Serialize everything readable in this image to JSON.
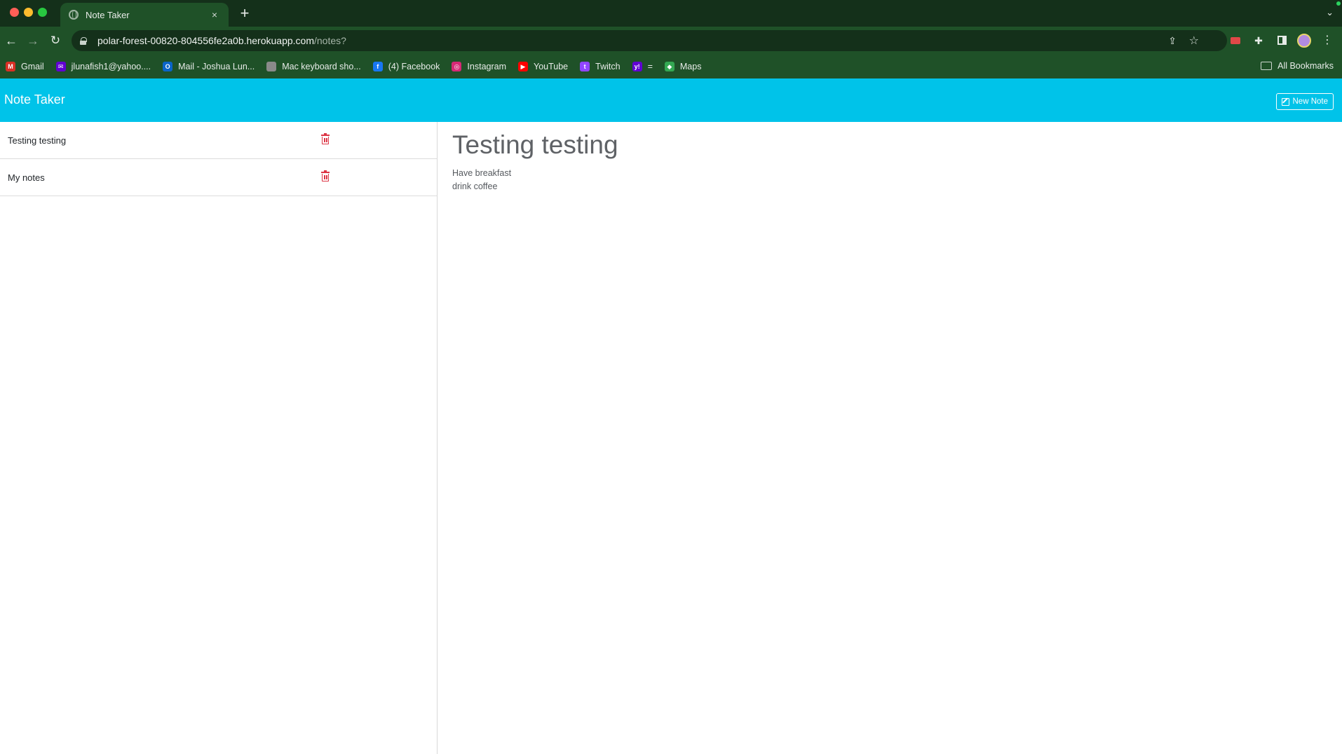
{
  "browser": {
    "tab_title": "Note Taker",
    "tab_close": "×",
    "new_tab": "+",
    "tab_menu": "⌄",
    "url_host": "polar-forest-00820-804556fe2a0b.herokuapp.com",
    "url_path": "/notes?",
    "bookmarks": [
      {
        "label": "Gmail",
        "icon": "gmail-icon",
        "color": "#d93025",
        "glyph": "M"
      },
      {
        "label": "jlunafish1@yahoo....",
        "icon": "yahoo-mail-icon",
        "color": "#6001d2",
        "glyph": "✉"
      },
      {
        "label": "Mail - Joshua Lun...",
        "icon": "outlook-icon",
        "color": "#0a64c8",
        "glyph": "O"
      },
      {
        "label": "Mac keyboard sho...",
        "icon": "apple-icon",
        "color": "#8a8a8a",
        "glyph": ""
      },
      {
        "label": "(4) Facebook",
        "icon": "facebook-icon",
        "color": "#1877f2",
        "glyph": "f"
      },
      {
        "label": "Instagram",
        "icon": "instagram-icon",
        "color": "#d62976",
        "glyph": "◎"
      },
      {
        "label": "YouTube",
        "icon": "youtube-icon",
        "color": "#ff0000",
        "glyph": "▶"
      },
      {
        "label": "Twitch",
        "icon": "twitch-icon",
        "color": "#9146ff",
        "glyph": "t"
      },
      {
        "label": "=",
        "icon": "yahoo-icon",
        "color": "#6001d2",
        "glyph": "y!"
      },
      {
        "label": "Maps",
        "icon": "maps-icon",
        "color": "#34a853",
        "glyph": "◆"
      }
    ],
    "all_bookmarks": "All Bookmarks"
  },
  "app": {
    "brand": "Note Taker",
    "new_note_label": "New Note",
    "accent_color": "#00c3e9",
    "delete_color": "#dc3545"
  },
  "notes": [
    {
      "title": "Testing testing"
    },
    {
      "title": "My notes"
    }
  ],
  "active_note": {
    "title": "Testing testing",
    "body": "Have breakfast\ndrink coffee"
  }
}
